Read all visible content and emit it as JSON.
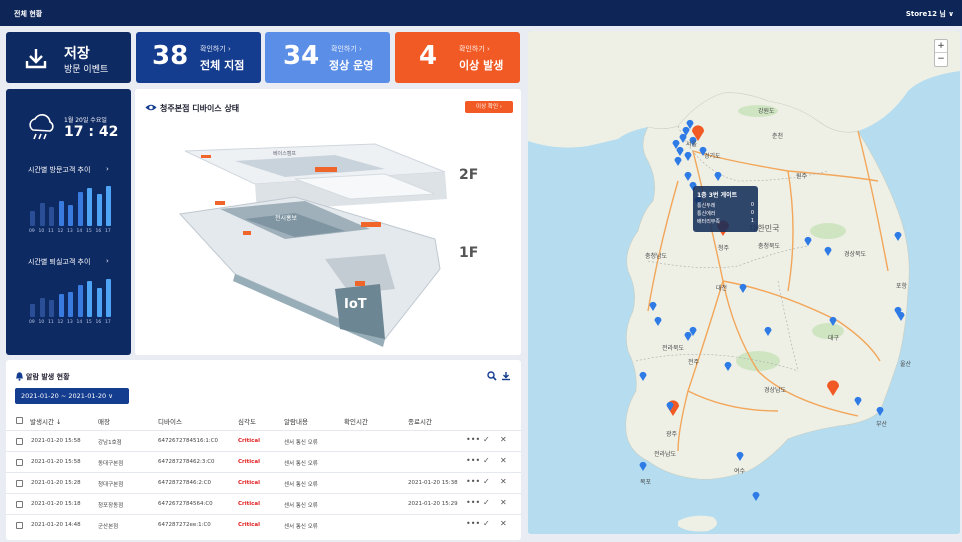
{
  "topbar": {
    "title": "전체 현황",
    "user": "Store12 님 ∨"
  },
  "kpis": {
    "save": {
      "title": "저장",
      "subtitle": "방문 이벤트"
    },
    "total": {
      "value": "38",
      "confirm": "확인하기  ›",
      "label": "전체 지점"
    },
    "normal": {
      "value": "34",
      "confirm": "확인하기  ›",
      "label": "정상 운영"
    },
    "alert": {
      "value": "4",
      "confirm": "확인하기  ›",
      "label": "이상 발생"
    }
  },
  "left": {
    "date": "1월 20일 수요일",
    "time": "17 : 42",
    "visit_title": "시간별 방문고객 추이",
    "leave_title": "시간별 퇴실고객 추이",
    "arrow": "›",
    "hours": [
      "09",
      "10",
      "11",
      "12",
      "13",
      "14",
      "15",
      "16",
      "17"
    ],
    "visit_bars": [
      0.35,
      0.55,
      0.45,
      0.6,
      0.5,
      0.8,
      0.9,
      0.75,
      0.95
    ],
    "leave_bars": [
      0.3,
      0.45,
      0.4,
      0.55,
      0.6,
      0.75,
      0.85,
      0.7,
      0.9
    ]
  },
  "device": {
    "title": "청주본점 디바이스 상태",
    "alert_button": "이상 확인 ›",
    "floor2": "2F",
    "floor1": "1F",
    "iot": "IoT",
    "room_top": "베이스캠프",
    "room_mid": "전시홍보"
  },
  "alarm": {
    "title": "알람 발생 현황",
    "date_range": "2021-01-20  ~  2021-01-20  ∨",
    "columns": [
      "발생시간 ↓",
      "매장",
      "디바이스",
      "심각도",
      "알람내용",
      "확인시간",
      "종료시간"
    ],
    "rows": [
      {
        "time": "2021-01-20 15:58",
        "store": "강남1호점",
        "device": "6472672784516:1:C0",
        "severity": "Critical",
        "content": "센서 통신 오류",
        "confirm": "",
        "end": ""
      },
      {
        "time": "2021-01-20 15:58",
        "store": "동대구본점",
        "device": "647287278462:3:C0",
        "severity": "Critical",
        "content": "센서 통신 오류",
        "confirm": "",
        "end": ""
      },
      {
        "time": "2021-01-20 15:28",
        "store": "청대구본점",
        "device": "64728727846:2:C0",
        "severity": "Critical",
        "content": "센서 통신 오류",
        "confirm": "",
        "end": "2021-01-20 15:38"
      },
      {
        "time": "2021-01-20 15:18",
        "store": "청포장동점",
        "device": "6472672784564:C0",
        "severity": "Critical",
        "content": "센서 통신 오류",
        "confirm": "",
        "end": "2021-01-20 15:29"
      },
      {
        "time": "2021-01-20 14:48",
        "store": "군산본점",
        "device": "647287272ee:1:C0",
        "severity": "Critical",
        "content": "센서 통신 오류",
        "confirm": "",
        "end": ""
      }
    ]
  },
  "map": {
    "zoom_in": "+",
    "zoom_out": "−",
    "tooltip": {
      "title": "1층 3번 게이트",
      "rows": [
        {
          "label": "통신두레",
          "value": "0"
        },
        {
          "label": "통신에러",
          "value": "0"
        },
        {
          "label": "배터리부족",
          "value": "1"
        }
      ]
    },
    "labels": {
      "country": "대한민국",
      "gangwon": "강원도",
      "gyeonggi": "경기도",
      "chungbuk": "충청북도",
      "chungnam": "충청남도",
      "gyeongbuk": "경상북도",
      "gyeongnam": "경상남도",
      "jeonbuk": "전라북도",
      "jeonnam": "전라남도",
      "daegu": "대구",
      "daejeon": "대전",
      "busan": "부산",
      "ulsan": "울산",
      "gwangju": "광주",
      "jeonju": "전주",
      "cheongju": "청주",
      "chuncheon": "춘천",
      "wonju": "원주",
      "pohang": "포항",
      "yeosu": "여수",
      "mokpo": "목포",
      "seoul": "서울"
    }
  },
  "colors": {
    "navy": "#0e2a63",
    "blue": "#143c8f",
    "light_blue": "#5b8ee6",
    "orange": "#f15a24"
  }
}
